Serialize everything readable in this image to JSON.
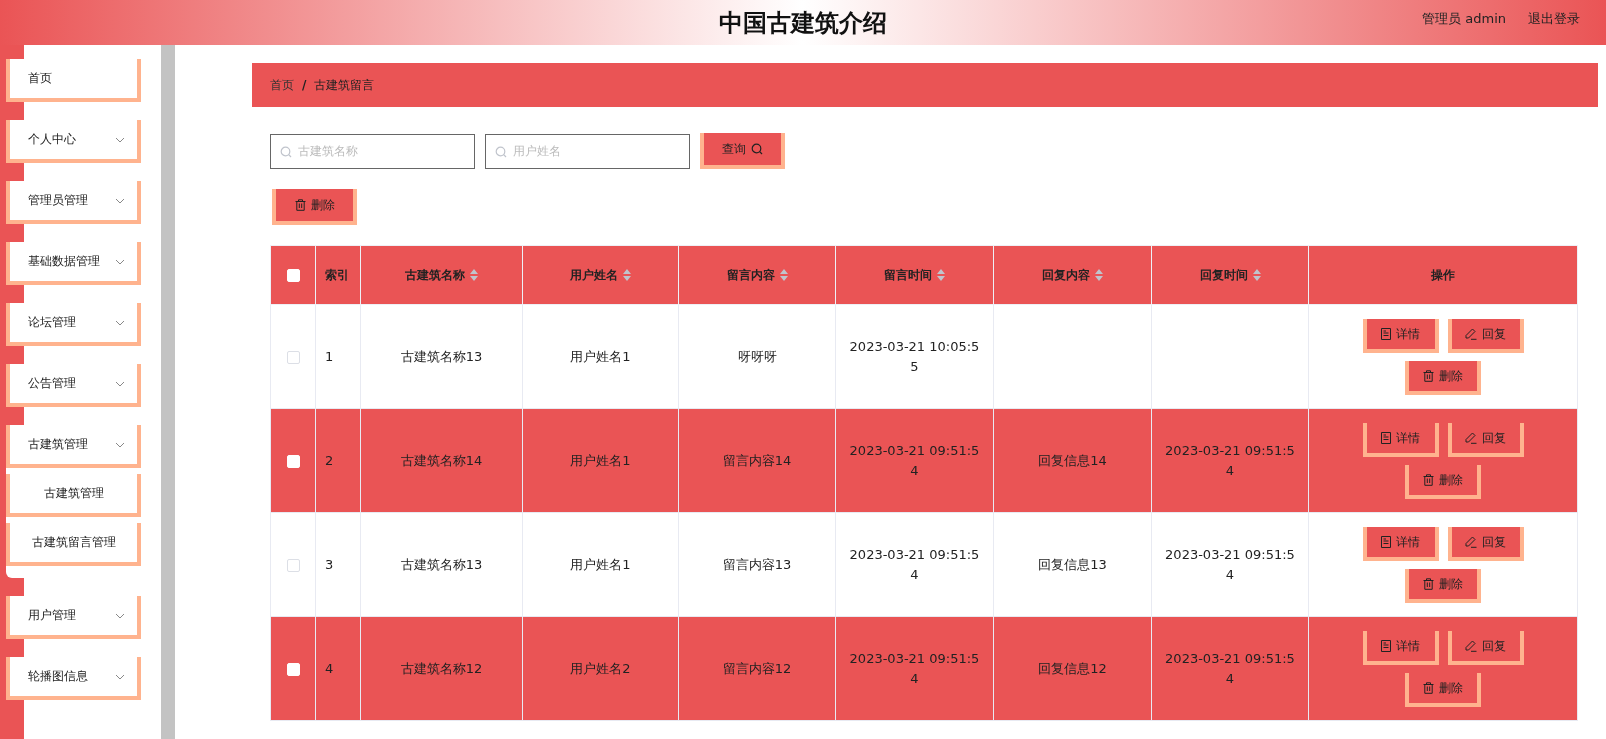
{
  "header": {
    "title": "中国古建筑介绍",
    "user": "管理员 admin",
    "logout": "退出登录"
  },
  "sidebar": {
    "items": [
      {
        "kind": "link",
        "label": "首页"
      },
      {
        "kind": "group",
        "label": "个人中心"
      },
      {
        "kind": "group",
        "label": "管理员管理"
      },
      {
        "kind": "group",
        "label": "基础数据管理"
      },
      {
        "kind": "group",
        "label": "论坛管理"
      },
      {
        "kind": "group",
        "label": "公告管理"
      },
      {
        "kind": "group",
        "label": "古建筑管理",
        "expanded": true,
        "children": [
          {
            "label": "古建筑管理"
          },
          {
            "label": "古建筑留言管理"
          }
        ]
      },
      {
        "kind": "group",
        "label": "用户管理"
      },
      {
        "kind": "group",
        "label": "轮播图信息"
      }
    ]
  },
  "breadcrumb": {
    "items": [
      "首页",
      "古建筑留言"
    ],
    "separator": "/"
  },
  "search": {
    "fields": [
      {
        "placeholder": "古建筑名称"
      },
      {
        "placeholder": "用户姓名"
      }
    ],
    "button": "查询"
  },
  "toolbar": {
    "delete_button": "删除"
  },
  "table": {
    "select_all": {
      "checked": false
    },
    "columns": [
      {
        "label": "索引",
        "sortable": false
      },
      {
        "label": "古建筑名称",
        "sortable": true
      },
      {
        "label": "用户姓名",
        "sortable": true
      },
      {
        "label": "留言内容",
        "sortable": true
      },
      {
        "label": "留言时间",
        "sortable": true
      },
      {
        "label": "回复内容",
        "sortable": true
      },
      {
        "label": "回复时间",
        "sortable": true
      },
      {
        "label": "操作",
        "sortable": false
      }
    ],
    "rows": [
      {
        "checked": false,
        "cells": [
          "1",
          "古建筑名称13",
          "用户姓名1",
          "呀呀呀",
          "2023-03-21 10:05:55",
          "",
          ""
        ],
        "actions": [
          {
            "kind": "detail",
            "label": "详情"
          },
          {
            "kind": "reply",
            "label": "回复"
          },
          {
            "kind": "delete",
            "label": "删除"
          }
        ]
      },
      {
        "checked": false,
        "cells": [
          "2",
          "古建筑名称14",
          "用户姓名1",
          "留言内容14",
          "2023-03-21 09:51:54",
          "回复信息14",
          "2023-03-21 09:51:54"
        ],
        "actions": [
          {
            "kind": "detail",
            "label": "详情"
          },
          {
            "kind": "reply",
            "label": "回复"
          },
          {
            "kind": "delete",
            "label": "删除"
          }
        ]
      },
      {
        "checked": false,
        "cells": [
          "3",
          "古建筑名称13",
          "用户姓名1",
          "留言内容13",
          "2023-03-21 09:51:54",
          "回复信息13",
          "2023-03-21 09:51:54"
        ],
        "actions": [
          {
            "kind": "detail",
            "label": "详情"
          },
          {
            "kind": "reply",
            "label": "回复"
          },
          {
            "kind": "delete",
            "label": "删除"
          }
        ]
      },
      {
        "checked": false,
        "cells": [
          "4",
          "古建筑名称12",
          "用户姓名2",
          "留言内容12",
          "2023-03-21 09:51:54",
          "回复信息12",
          "2023-03-21 09:51:54"
        ],
        "actions": [
          {
            "kind": "detail",
            "label": "详情"
          },
          {
            "kind": "reply",
            "label": "回复"
          },
          {
            "kind": "delete",
            "label": "删除"
          }
        ]
      }
    ]
  }
}
